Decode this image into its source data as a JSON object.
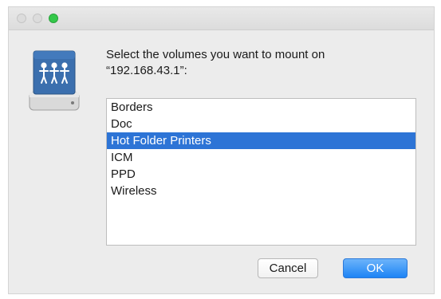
{
  "window": {
    "traffic_lights": [
      {
        "name": "close",
        "state": "inactive"
      },
      {
        "name": "minimize",
        "state": "inactive"
      },
      {
        "name": "zoom",
        "state": "active",
        "color": "#34c84a"
      }
    ]
  },
  "dialog": {
    "icon": "network-volume-drive-icon",
    "prompt_line1": "Select the volumes you want to mount on",
    "prompt_line2": "“192.168.43.1”:"
  },
  "volumes": {
    "items": [
      {
        "label": "Borders",
        "selected": false
      },
      {
        "label": "Doc",
        "selected": false
      },
      {
        "label": "Hot Folder Printers",
        "selected": true
      },
      {
        "label": "ICM",
        "selected": false
      },
      {
        "label": "PPD",
        "selected": false
      },
      {
        "label": "Wireless",
        "selected": false
      }
    ],
    "selected_color": "#2d74d6"
  },
  "buttons": {
    "cancel_label": "Cancel",
    "ok_label": "OK",
    "default_color": "#1d84f5"
  }
}
